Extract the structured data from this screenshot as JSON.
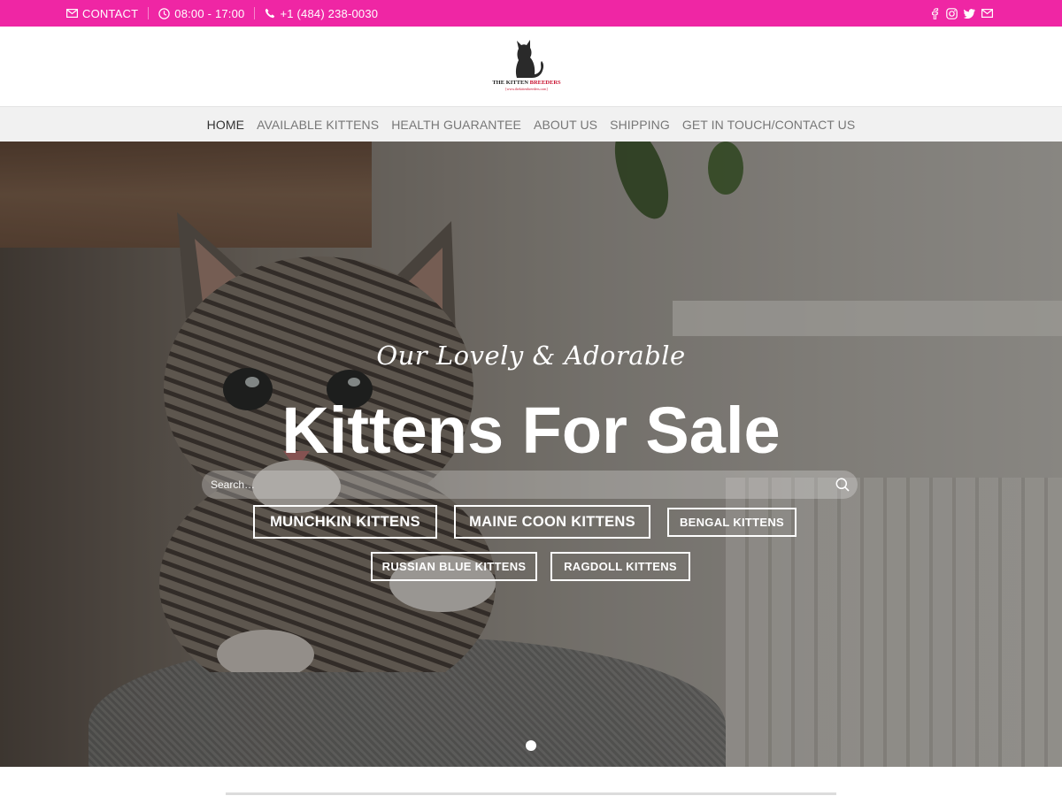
{
  "topbar": {
    "contact_label": "CONTACT",
    "hours": "08:00 - 17:00",
    "phone": "+1 (484) 238-0030",
    "color": "#ef26a4",
    "social_icons": [
      "facebook-icon",
      "instagram-icon",
      "twitter-icon",
      "envelope-icon"
    ]
  },
  "header": {
    "logo_text_primary": "THE KITTEN",
    "logo_text_secondary": "BREEDERS",
    "logo_url": "[www.thekittenbreeders.com]"
  },
  "nav": {
    "items": [
      {
        "label": "HOME",
        "active": true
      },
      {
        "label": "AVAILABLE KITTENS",
        "active": false
      },
      {
        "label": "HEALTH GUARANTEE",
        "active": false
      },
      {
        "label": "ABOUT US",
        "active": false
      },
      {
        "label": "SHIPPING",
        "active": false
      },
      {
        "label": "GET IN TOUCH/CONTACT US",
        "active": false
      }
    ]
  },
  "hero": {
    "tagline": "Our Lovely & Adorable",
    "headline": "Kittens For Sale",
    "search_placeholder": "Search…",
    "buttons": [
      "MUNCHKIN KITTENS",
      "MAINE COON KITTENS",
      "BENGAL KITTENS",
      "RUSSIAN BLUE KITTENS",
      "RAGDOLL KITTENS"
    ]
  }
}
